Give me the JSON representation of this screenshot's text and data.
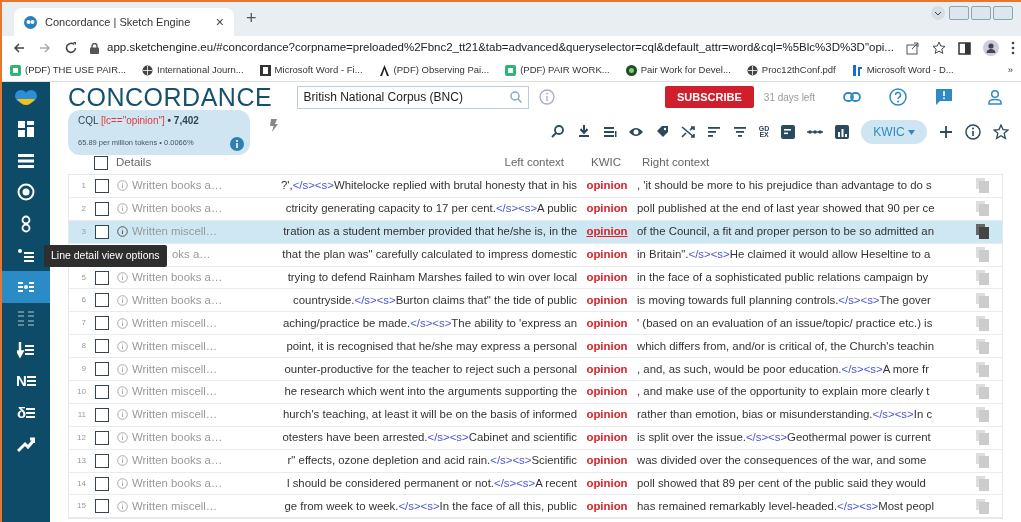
{
  "browser": {
    "tab": {
      "title": "Concordance | Sketch Engine",
      "close": "×"
    },
    "new_tab": "+",
    "address": "app.sketchengine.eu/#concordance?corpname=preloaded%2Fbnc2_tt21&tab=advanced&queryselector=cql&default_attr=word&cql=%5Blc%3D%3D\"opi...",
    "bookmarks": [
      {
        "label": "(PDF) THE USE PAIR...",
        "kind": "green"
      },
      {
        "label": "International Journ...",
        "kind": "globe"
      },
      {
        "label": "Microsoft Word - Fi...",
        "kind": "doc"
      },
      {
        "label": "(PDF) Observing Pai...",
        "kind": "letter"
      },
      {
        "label": "(PDF) PAIR WORK...",
        "kind": "green"
      },
      {
        "label": "Pair Work for Devel...",
        "kind": "dark"
      },
      {
        "label": "Proc12thConf.pdf",
        "kind": "globe"
      },
      {
        "label": "Microsoft Word - D...",
        "kind": "blue"
      }
    ],
    "more": "»"
  },
  "sidebar": {
    "items": [
      {
        "selected": false,
        "disabled": false
      },
      {
        "selected": false,
        "disabled": false
      },
      {
        "selected": false,
        "disabled": false
      },
      {
        "selected": false,
        "disabled": false
      },
      {
        "selected": false,
        "disabled": false
      },
      {
        "selected": true,
        "disabled": false
      },
      {
        "selected": false,
        "disabled": true
      },
      {
        "selected": false,
        "disabled": false
      },
      {
        "selected": false,
        "disabled": false,
        "glyph": "N"
      },
      {
        "selected": false,
        "disabled": false,
        "glyph": "δ"
      },
      {
        "selected": false,
        "disabled": false
      }
    ]
  },
  "header": {
    "title": "CONCORDANCE",
    "corpus": "British National Corpus (BNC)",
    "subscribe": "SUBSCRIBE",
    "days_left": "31 days left"
  },
  "query": {
    "type": "CQL",
    "expression": "[lc==\"opinion\"]",
    "count": "• 7,402",
    "stats": "65.89 per million tokens • 0.0066%"
  },
  "toolbar": {
    "gdex": [
      "GD",
      "EX"
    ],
    "view": "KWIC"
  },
  "table": {
    "columns": {
      "details": "Details",
      "left": "Left context",
      "kwic": "KWIC",
      "right": "Right context"
    },
    "select_all": {
      "checked": false
    },
    "tooltip": {
      "text": "Line detail view options"
    },
    "rows": [
      {
        "number": "1",
        "checked": false,
        "selected": false,
        "details": "Written books a…",
        "left": [
          {
            "kind": "text",
            "text": "?',"
          },
          {
            "kind": "tag",
            "text": "</s><s>"
          },
          {
            "kind": "text",
            "text": "Whitelocke replied with brutal honesty that in his"
          }
        ],
        "kwic": "opinion",
        "right": [
          {
            "kind": "text",
            "text": ", 'it should be more to his prejudice than advantage to do s"
          }
        ]
      },
      {
        "number": "2",
        "checked": false,
        "selected": false,
        "details": "Written books a…",
        "left": [
          {
            "kind": "text",
            "text": "ctricity generating capacity to 17 per cent."
          },
          {
            "kind": "tag",
            "text": "</s><s>"
          },
          {
            "kind": "text",
            "text": "A public"
          }
        ],
        "kwic": "opinion",
        "right": [
          {
            "kind": "text",
            "text": "poll published at the end of last year showed that 90 per ce"
          }
        ]
      },
      {
        "number": "3",
        "checked": false,
        "selected": true,
        "details": "Written miscell…",
        "left": [
          {
            "kind": "text",
            "text": "tration as a student member provided that he/she is, in the"
          }
        ],
        "kwic": "opinion",
        "right": [
          {
            "kind": "text",
            "text": "of the Council, a fit and proper person to be so admitted an"
          }
        ]
      },
      {
        "selected": false,
        "details": "oks a…",
        "left": [
          {
            "kind": "text",
            "text": "that the plan was\" carefully calculated to impress domestic"
          }
        ],
        "kwic": "opinion",
        "right": [
          {
            "kind": "text",
            "text": "in Britain\"."
          },
          {
            "kind": "tag",
            "text": "</s><s>"
          },
          {
            "kind": "text",
            "text": "He claimed it would allow Heseltine to a"
          }
        ]
      },
      {
        "number": "5",
        "checked": false,
        "selected": false,
        "details": "Written books a…",
        "left": [
          {
            "kind": "text",
            "text": "trying to defend Rainham Marshes failed to win over local"
          }
        ],
        "kwic": "opinion",
        "right": [
          {
            "kind": "text",
            "text": "in the face of a sophisticated public relations campaign by"
          }
        ]
      },
      {
        "number": "6",
        "checked": false,
        "selected": false,
        "details": "Written books a…",
        "left": [
          {
            "kind": "text",
            "text": "countryside."
          },
          {
            "kind": "tag",
            "text": "</s><s>"
          },
          {
            "kind": "text",
            "text": "Burton claims that\" the tide of public"
          }
        ],
        "kwic": "opinion",
        "right": [
          {
            "kind": "text",
            "text": "is moving towards full planning controls."
          },
          {
            "kind": "tag",
            "text": "</s><s>"
          },
          {
            "kind": "text",
            "text": "The gover"
          }
        ]
      },
      {
        "number": "7",
        "checked": false,
        "selected": false,
        "details": "Written miscell…",
        "left": [
          {
            "kind": "text",
            "text": "aching/practice be made."
          },
          {
            "kind": "tag",
            "text": "</s><s>"
          },
          {
            "kind": "text",
            "text": "The ability to 'express an"
          }
        ],
        "kwic": "opinion",
        "right": [
          {
            "kind": "text",
            "text": "' (based on an evaluation of an issue/topic/ practice etc.) is"
          }
        ]
      },
      {
        "number": "8",
        "checked": false,
        "selected": false,
        "details": "Written miscell…",
        "left": [
          {
            "kind": "text",
            "text": "point, it is recognised that he/she may express a personal"
          }
        ],
        "kwic": "opinion",
        "right": [
          {
            "kind": "text",
            "text": "which differs from, and/or is critical of, the Church's teachin"
          }
        ]
      },
      {
        "number": "9",
        "checked": false,
        "selected": false,
        "details": "Written miscell…",
        "left": [
          {
            "kind": "text",
            "text": "ounter-productive for the teacher to reject such a personal"
          }
        ],
        "kwic": "opinion",
        "right": [
          {
            "kind": "text",
            "text": ", and, as such, would be poor education."
          },
          {
            "kind": "tag",
            "text": "</s><s>"
          },
          {
            "kind": "text",
            "text": "A more fr"
          }
        ]
      },
      {
        "number": "10",
        "checked": false,
        "selected": false,
        "details": "Written miscell…",
        "left": [
          {
            "kind": "text",
            "text": "he research which went into the arguments supporting the"
          }
        ],
        "kwic": "opinion",
        "right": [
          {
            "kind": "text",
            "text": ", and make use of the opportunity to explain more clearly t"
          }
        ]
      },
      {
        "number": "11",
        "checked": false,
        "selected": false,
        "details": "Written miscell…",
        "left": [
          {
            "kind": "text",
            "text": "hurch's teaching, at least it will be on the basis of informed"
          }
        ],
        "kwic": "opinion",
        "right": [
          {
            "kind": "text",
            "text": "rather than emotion, bias or misunderstanding."
          },
          {
            "kind": "tag",
            "text": "</s><s>"
          },
          {
            "kind": "text",
            "text": "In c"
          }
        ]
      },
      {
        "number": "12",
        "checked": false,
        "selected": false,
        "details": "Written books a…",
        "left": [
          {
            "kind": "text",
            "text": "otesters have been arrested."
          },
          {
            "kind": "tag",
            "text": "</s><s>"
          },
          {
            "kind": "text",
            "text": "Cabinet and scientific"
          }
        ],
        "kwic": "opinion",
        "right": [
          {
            "kind": "text",
            "text": "is split over the issue."
          },
          {
            "kind": "tag",
            "text": "</s><s>"
          },
          {
            "kind": "text",
            "text": "Geothermal power is current"
          }
        ]
      },
      {
        "number": "13",
        "checked": false,
        "selected": false,
        "details": "Written books a…",
        "left": [
          {
            "kind": "text",
            "text": "r\" effects, ozone depletion and acid rain."
          },
          {
            "kind": "tag",
            "text": "</s><s>"
          },
          {
            "kind": "text",
            "text": "Scientific"
          }
        ],
        "kwic": "opinion",
        "right": [
          {
            "kind": "text",
            "text": "was divided over the consequences of the war, and some"
          }
        ]
      },
      {
        "number": "14",
        "checked": false,
        "selected": false,
        "details": "Written books a…",
        "left": [
          {
            "kind": "text",
            "text": "l should be considered permanent or not."
          },
          {
            "kind": "tag",
            "text": "</s><s>"
          },
          {
            "kind": "text",
            "text": "A recent"
          }
        ],
        "kwic": "opinion",
        "right": [
          {
            "kind": "text",
            "text": "poll showed that 89 per cent of the public said they would"
          }
        ]
      },
      {
        "number": "15",
        "checked": false,
        "selected": false,
        "details": "Written miscell…",
        "left": [
          {
            "kind": "text",
            "text": "ge from week to week."
          },
          {
            "kind": "tag",
            "text": "</s><s>"
          },
          {
            "kind": "text",
            "text": "In the face of all this, public"
          }
        ],
        "kwic": "opinion",
        "right": [
          {
            "kind": "text",
            "text": "has remained remarkably level-headed."
          },
          {
            "kind": "tag",
            "text": "</s><s>"
          },
          {
            "kind": "text",
            "text": "Most peopl"
          }
        ]
      }
    ]
  }
}
